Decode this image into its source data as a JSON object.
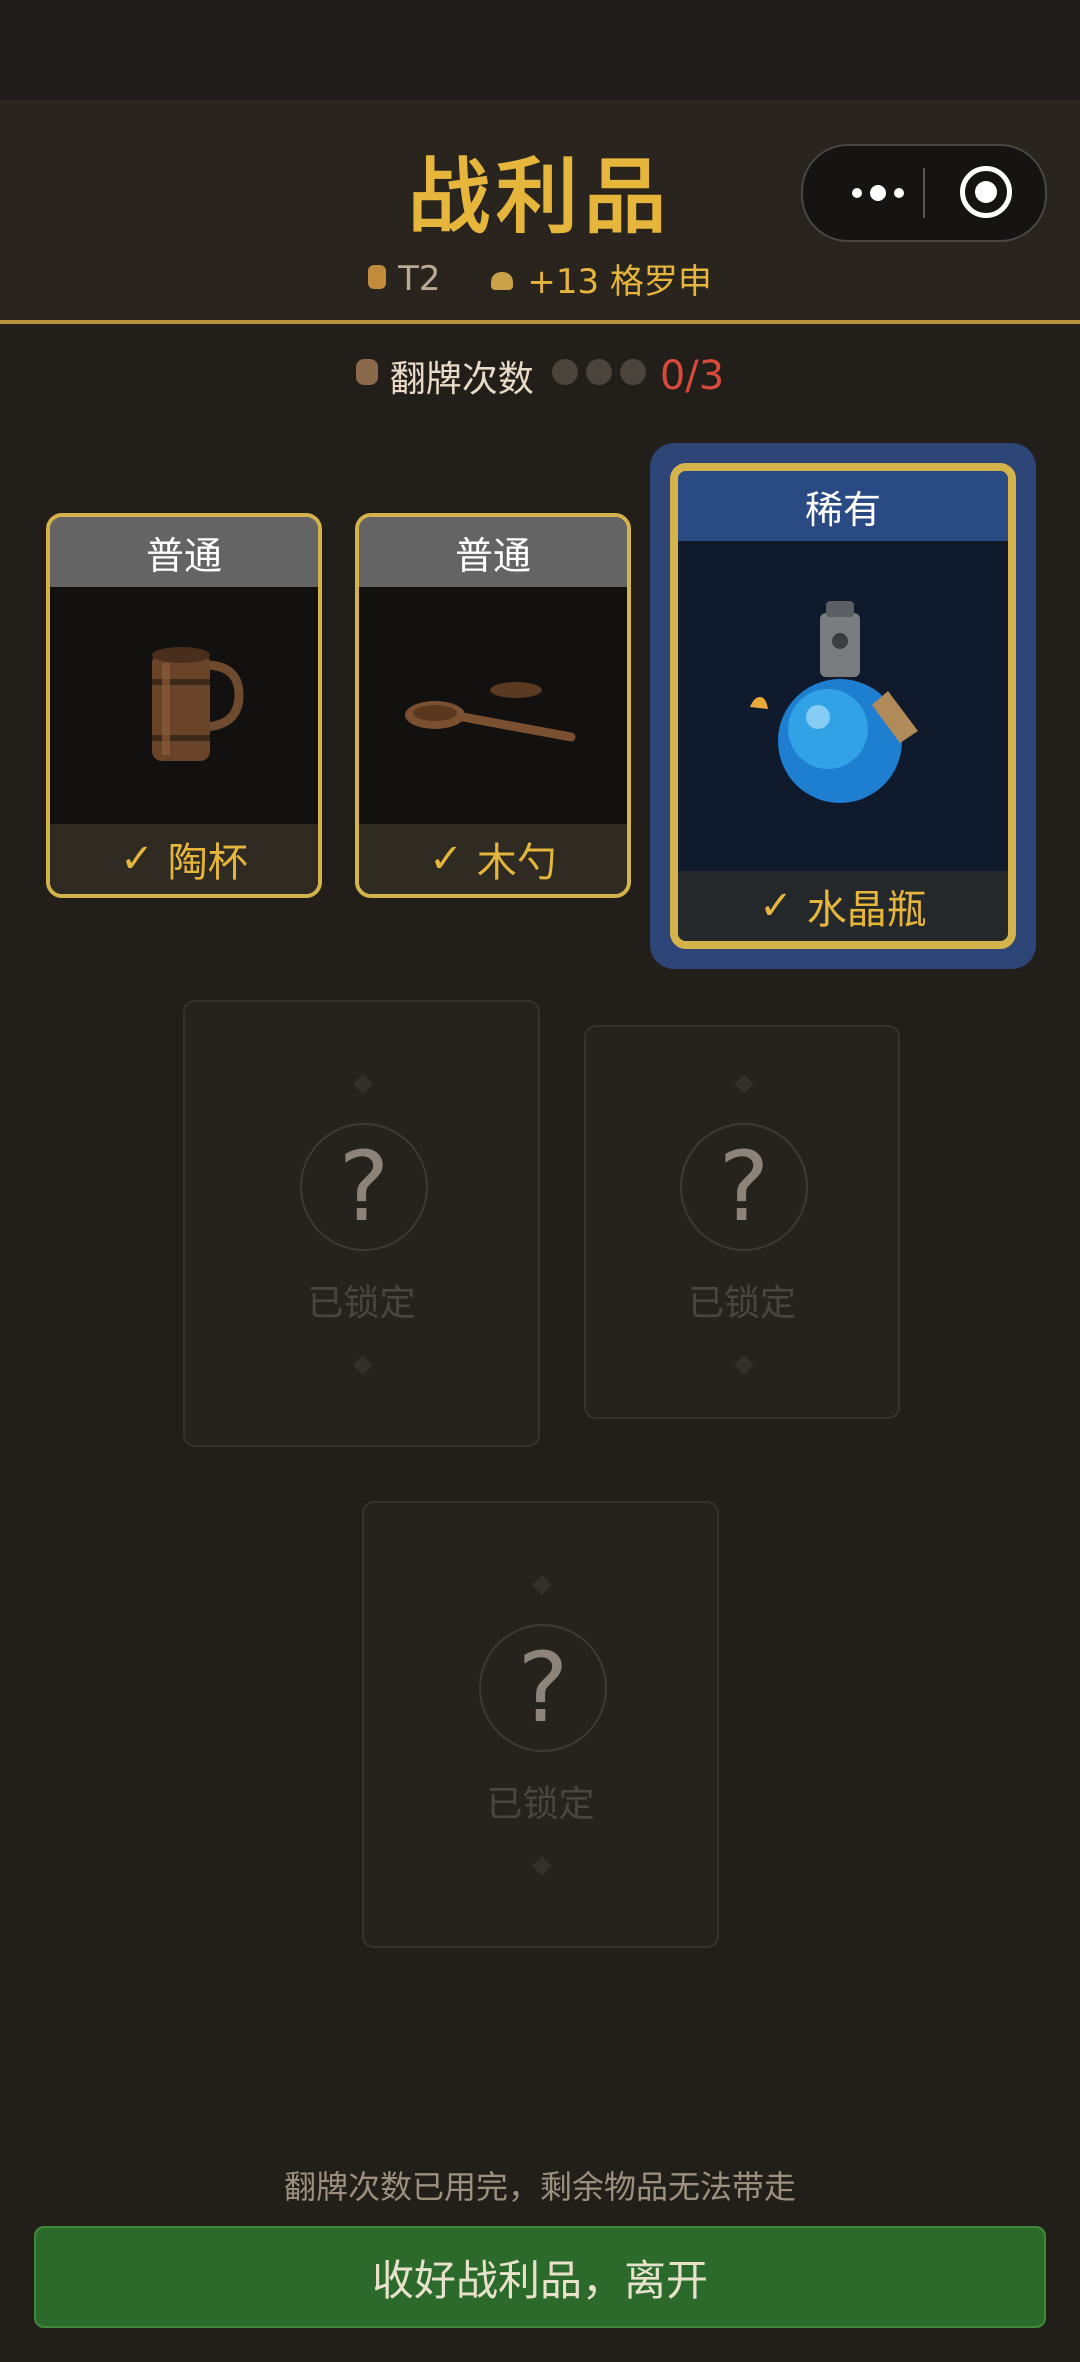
{
  "header": {
    "title": "战利品",
    "tier": "T2",
    "reward": "+13 格罗申"
  },
  "flips": {
    "label": "翻牌次数",
    "used": 0,
    "total": 3,
    "count_text": "0/3"
  },
  "cards": [
    {
      "rarity": "普通",
      "name": "陶杯",
      "check": "✓"
    },
    {
      "rarity": "普通",
      "name": "木勺",
      "check": "✓"
    },
    {
      "rarity": "稀有",
      "name": "水晶瓶",
      "check": "✓"
    }
  ],
  "locked_cards": [
    {
      "symbol": "?",
      "label": "已锁定"
    },
    {
      "symbol": "?",
      "label": "已锁定"
    },
    {
      "symbol": "?",
      "label": "已锁定"
    }
  ],
  "footer": {
    "notice": "翻牌次数已用完，剩余物品无法带走",
    "leave_button": "收好战利品，离开"
  },
  "colors": {
    "gold": "#e6b53b",
    "rare": "#2a4a84",
    "leave": "#2c6a2c",
    "count": "#d94a3b"
  },
  "icons": [
    "lock-icon",
    "coin-pouch-icon",
    "bag-icon",
    "more-icon",
    "target-icon",
    "check-icon",
    "mug-icon",
    "spoon-icon",
    "potion-icon"
  ]
}
